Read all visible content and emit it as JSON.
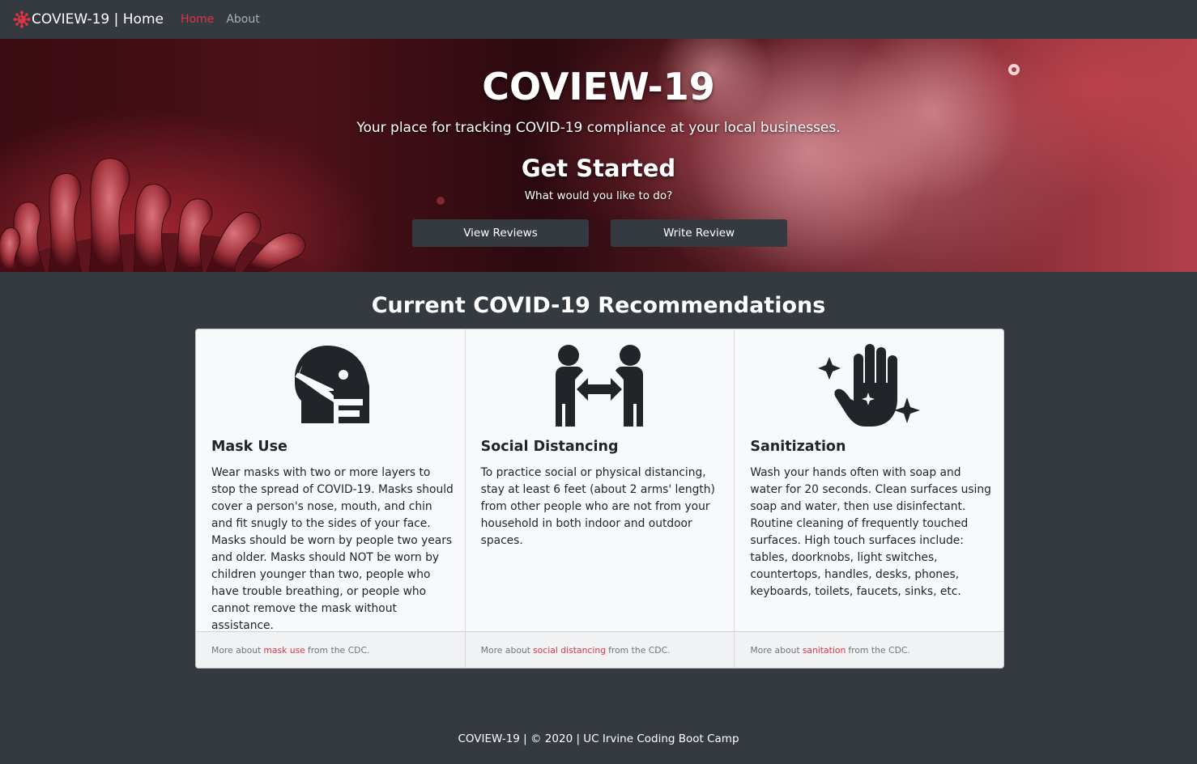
{
  "navbar": {
    "brand": "COVIEW-19 | Home",
    "links": [
      {
        "label": "Home",
        "active": true
      },
      {
        "label": "About",
        "active": false
      }
    ]
  },
  "hero": {
    "title": "COVIEW-19",
    "subtitle": "Your place for tracking COVID-19 compliance at your local businesses.",
    "heading": "Get Started",
    "question": "What would you like to do?",
    "buttons": {
      "view_reviews": "View Reviews",
      "write_review": "Write Review"
    }
  },
  "recommendations": {
    "title": "Current COVID-19 Recommendations",
    "cards": [
      {
        "icon": "head-mask-icon",
        "title": "Mask Use",
        "text": "Wear masks with two or more layers to stop the spread of COVID-19. Masks should cover a person's nose, mouth, and chin and fit snugly to the sides of your face. Masks should be worn by people two years and older. Masks should NOT be worn by children younger than two, people who have trouble breathing, or people who cannot remove the mask without assistance.",
        "footer_prefix": "More about",
        "footer_link": "mask use",
        "footer_suffix": "from the CDC."
      },
      {
        "icon": "people-arrows-icon",
        "title": "Social Distancing",
        "text": "To practice social or physical distancing, stay at least 6 feet (about 2 arms' length) from other people who are not from your household in both indoor and outdoor spaces.",
        "footer_prefix": "More about",
        "footer_link": "social distancing",
        "footer_suffix": "from the CDC."
      },
      {
        "icon": "hand-sparkles-icon",
        "title": "Sanitization",
        "text": "Wash your hands often with soap and water for 20 seconds. Clean surfaces using soap and water, then use disinfectant. Routine cleaning of frequently touched surfaces. High touch surfaces include: tables, doorknobs, light switches, countertops, handles, desks, phones, keyboards, toilets, faucets, sinks, etc.",
        "footer_prefix": "More about",
        "footer_link": "sanitation",
        "footer_suffix": "from the CDC."
      }
    ]
  },
  "footer": {
    "text": "COVIEW-19 | © 2020 | UC Irvine Coding Boot Camp"
  },
  "colors": {
    "background": "#343a40",
    "accent": "#dc3545",
    "card_bg": "#f8f9fa"
  }
}
